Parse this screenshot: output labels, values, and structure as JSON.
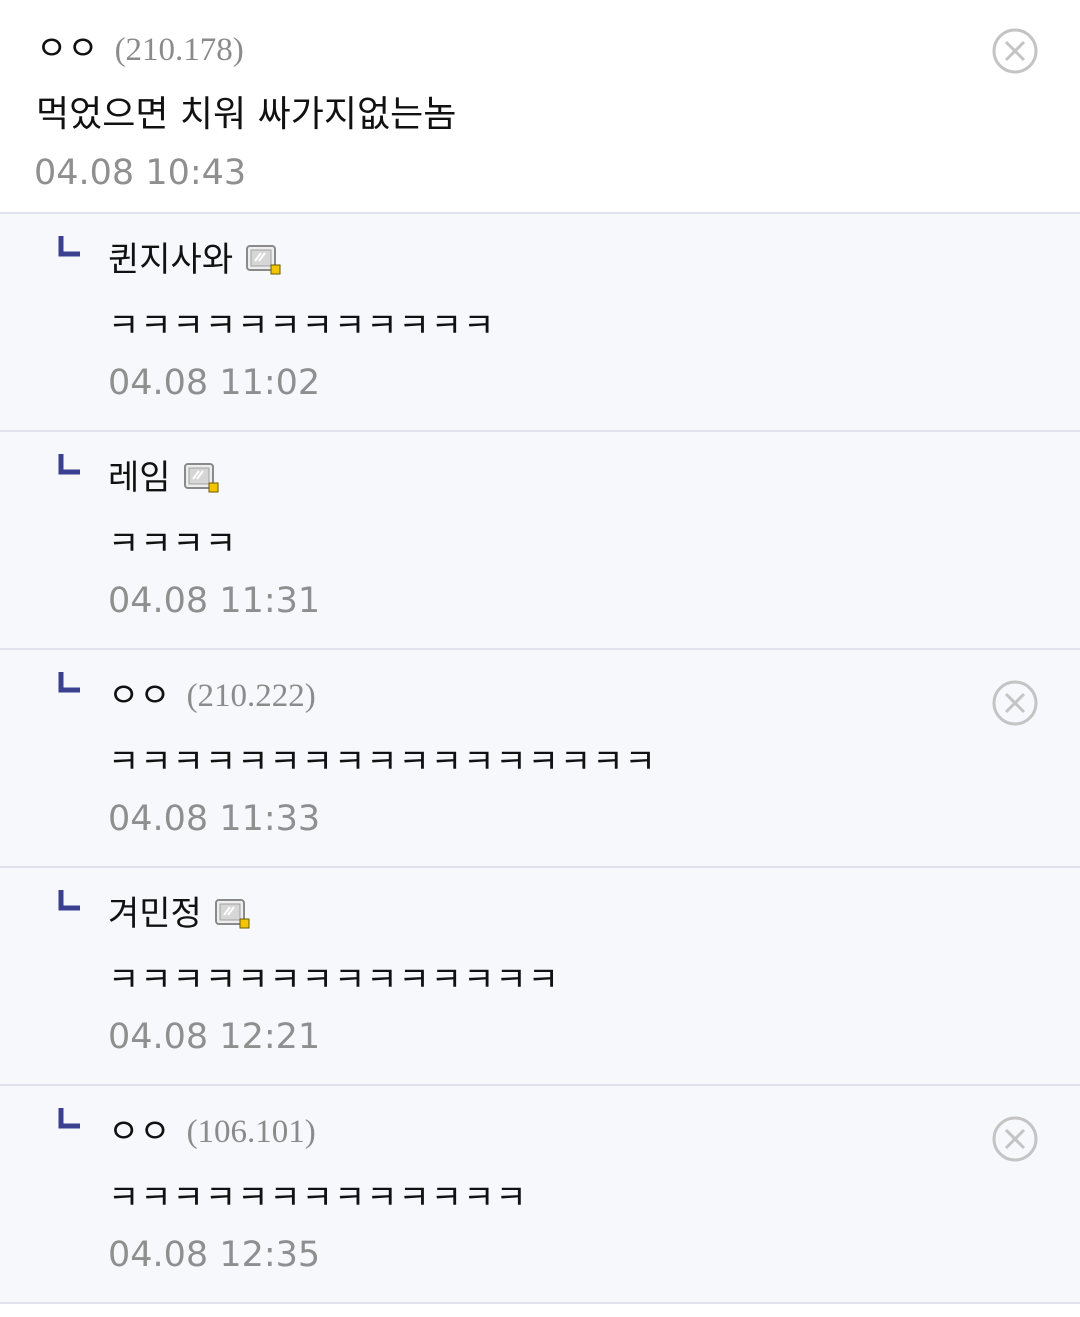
{
  "main_comment": {
    "nickname": "ㅇㅇ",
    "ip": "(210.178)",
    "body": "먹었으면 치워 싸가지없는놈",
    "time": "04.08 10:43"
  },
  "replies": [
    {
      "nickname": "퀸지사와",
      "ip": "",
      "has_badge": true,
      "has_delete": false,
      "body": "ㅋㅋㅋㅋㅋㅋㅋㅋㅋㅋㅋㅋ",
      "time": "04.08 11:02"
    },
    {
      "nickname": "레임",
      "ip": "",
      "has_badge": true,
      "has_delete": false,
      "body": "ㅋㅋㅋㅋ",
      "time": "04.08 11:31"
    },
    {
      "nickname": "ㅇㅇ",
      "ip": "(210.222)",
      "has_badge": false,
      "has_delete": true,
      "body": "ㅋㅋㅋㅋㅋㅋㅋㅋㅋㅋㅋㅋㅋㅋㅋㅋㅋ",
      "time": "04.08 11:33"
    },
    {
      "nickname": "겨민정",
      "ip": "",
      "has_badge": true,
      "has_delete": false,
      "body": "ㅋㅋㅋㅋㅋㅋㅋㅋㅋㅋㅋㅋㅋㅋ",
      "time": "04.08 12:21"
    },
    {
      "nickname": "ㅇㅇ",
      "ip": "(106.101)",
      "has_badge": false,
      "has_delete": true,
      "body": "ㅋㅋㅋㅋㅋㅋㅋㅋㅋㅋㅋㅋㅋ",
      "time": "04.08 12:35"
    }
  ],
  "icons": {
    "delete": "circle-x-icon",
    "reply_arrow": "reply-arrow-icon",
    "member_badge": "fixed-nick-badge-icon"
  },
  "colors": {
    "reply_background": "#f7f8fb",
    "divider": "#dfe2ea",
    "meta_text": "#8f8f8f",
    "arrow": "#3b3f8f",
    "badge_dot": "#f2c500"
  }
}
